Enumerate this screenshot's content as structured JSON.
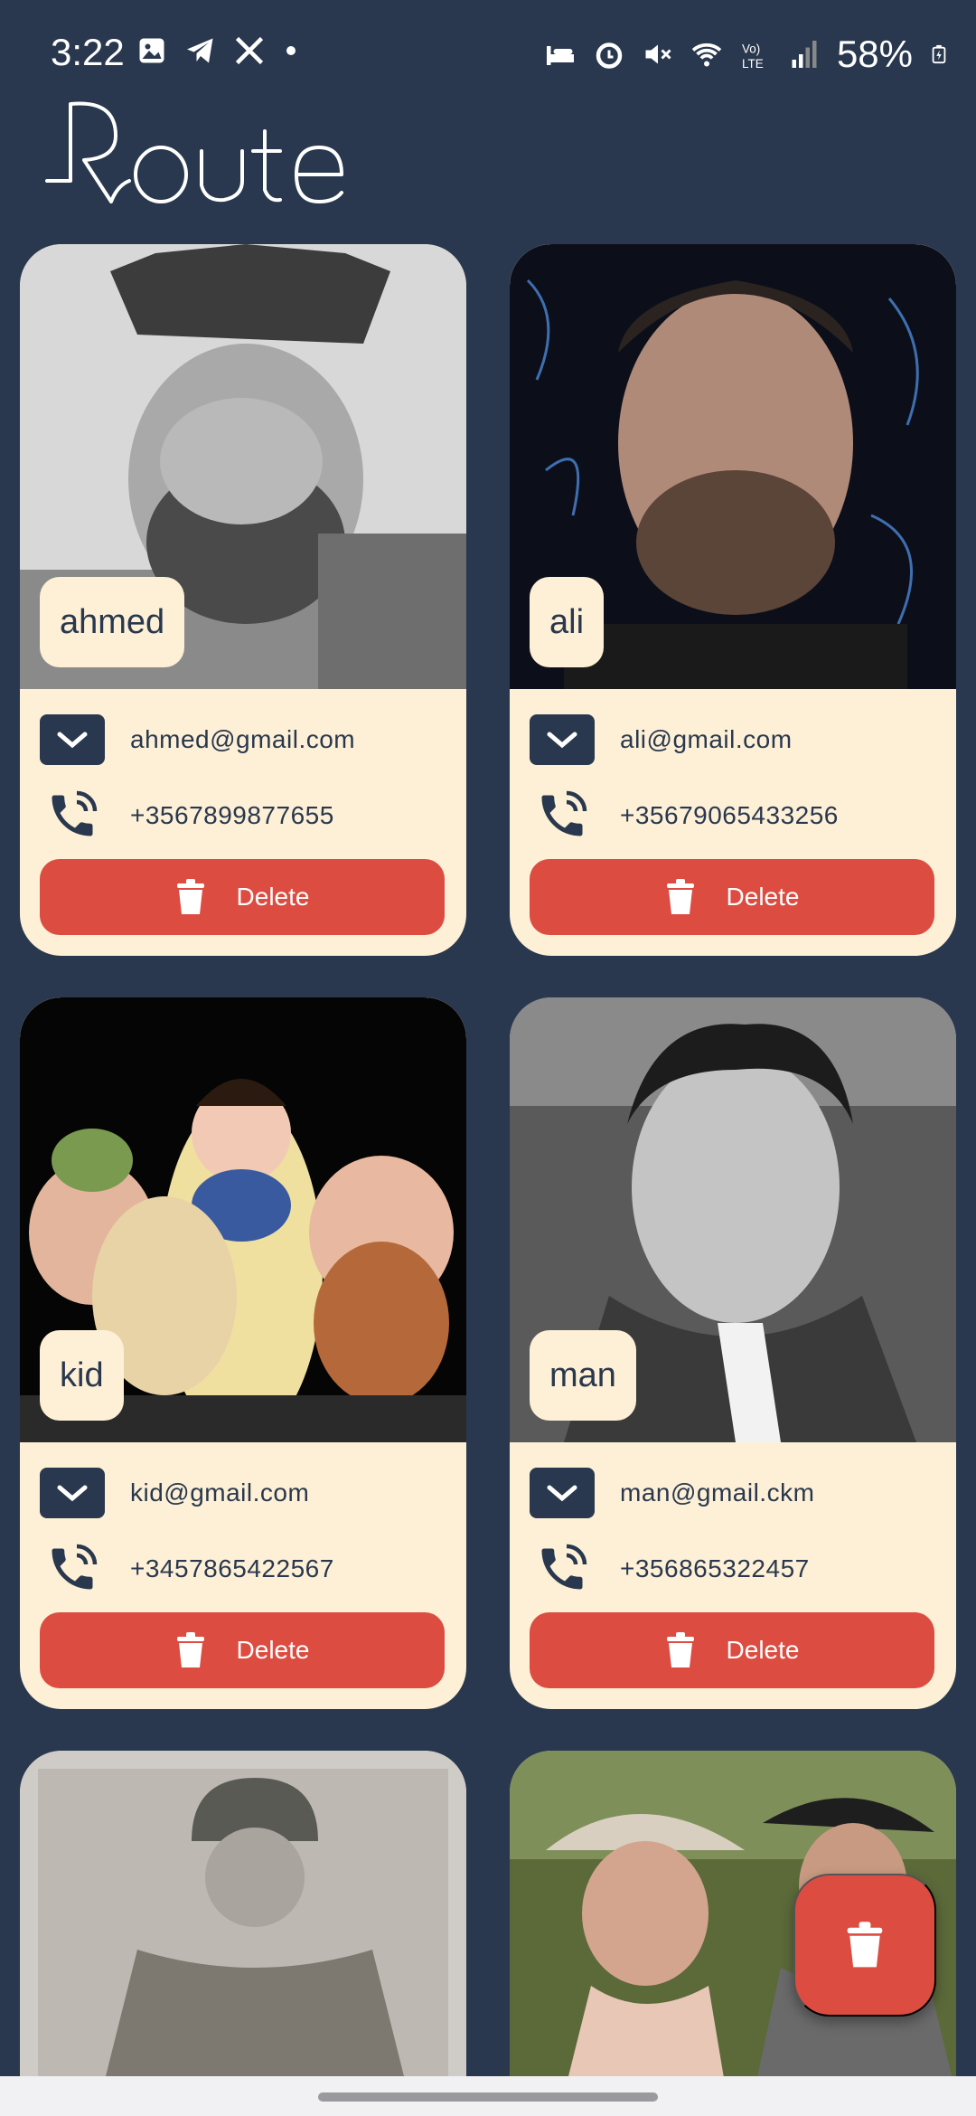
{
  "status_bar": {
    "time": "3:22",
    "battery": "58%",
    "icons_left": [
      "gallery-icon",
      "telegram-icon",
      "x-icon",
      "dot-icon"
    ],
    "icons_right": [
      "bed-icon",
      "alarm-icon",
      "mute-icon",
      "wifi-icon",
      "volte-icon",
      "signal-icon",
      "battery-icon"
    ]
  },
  "app": {
    "logo_text": "Route"
  },
  "colors": {
    "background": "#29384e",
    "card": "#fdf0d6",
    "delete": "#dc4c41",
    "text": "#29384e"
  },
  "contacts": [
    {
      "name": "ahmed",
      "email": "ahmed@gmail.com",
      "phone": "+3567899877655",
      "delete_label": "Delete",
      "photo": "bearded man with crown"
    },
    {
      "name": "ali",
      "email": "ali@gmail.com",
      "phone": "+35679065433256",
      "delete_label": "Delete",
      "photo": "man portrait doodle background"
    },
    {
      "name": "kid",
      "email": "kid@gmail.com",
      "phone": "+3457865422567",
      "delete_label": "Delete",
      "photo": "snow white figurines"
    },
    {
      "name": "man",
      "email": "man@gmail.ckm",
      "phone": "+356865322457",
      "delete_label": "Delete",
      "photo": "vintage actor portrait"
    }
  ],
  "fab": {
    "icon": "trash-icon"
  }
}
